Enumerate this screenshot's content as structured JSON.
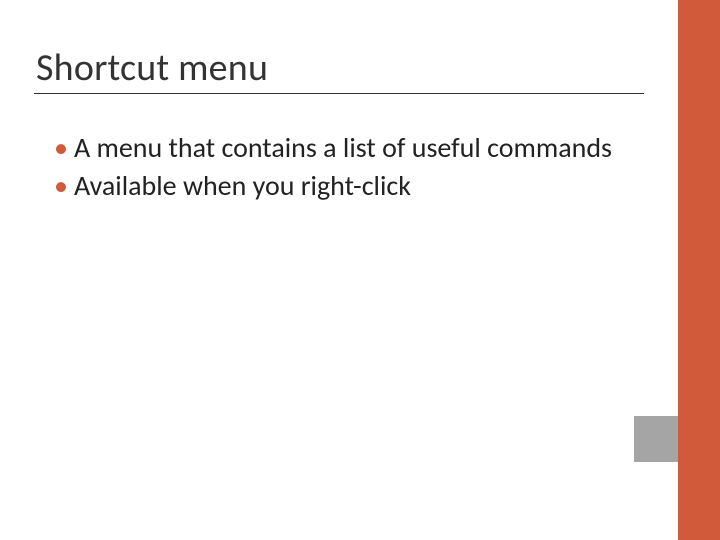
{
  "colors": {
    "accent": "#d15a3a",
    "gray": "#a5a5a5",
    "text": "#222222",
    "title": "#333333"
  },
  "slide": {
    "title": "Shortcut menu",
    "bullets": [
      "A menu that contains a list of useful commands",
      "Available when you right-click"
    ]
  }
}
